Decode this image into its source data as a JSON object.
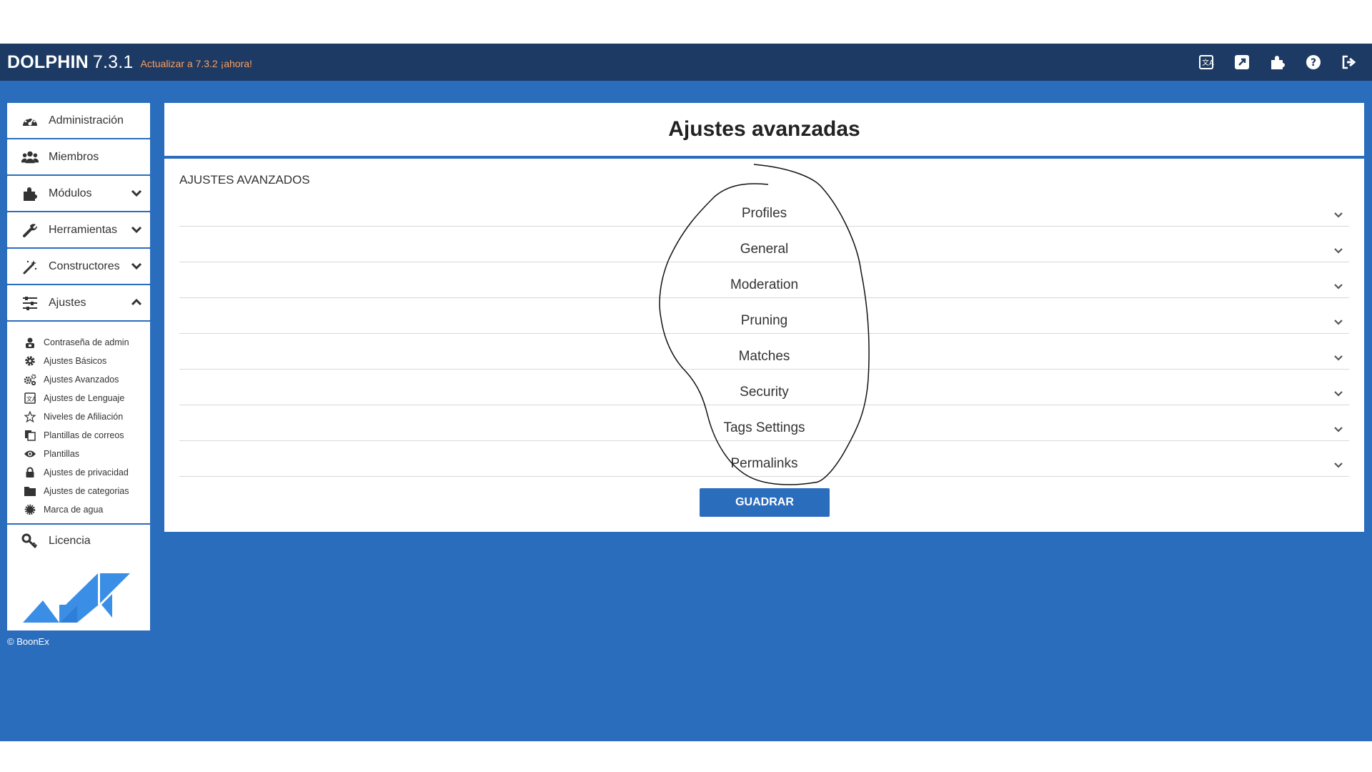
{
  "header": {
    "brand": "DOLPHIN",
    "version": "7.3.1",
    "upgrade_text": "Actualizar a 7.3.2 ¡ahora!",
    "icons": [
      "language-icon",
      "external-link-icon",
      "puzzle-icon",
      "help-icon",
      "logout-icon"
    ]
  },
  "sidebar": {
    "items": [
      {
        "label": "Administración",
        "icon": "dashboard-icon"
      },
      {
        "label": "Miembros",
        "icon": "users-icon"
      },
      {
        "label": "Módulos",
        "icon": "puzzle-icon"
      },
      {
        "label": "Herramientas",
        "icon": "wrench-icon"
      },
      {
        "label": "Constructores",
        "icon": "magic-wand-icon"
      },
      {
        "label": "Ajustes",
        "icon": "sliders-icon"
      }
    ],
    "submenu": [
      {
        "label": "Contraseña de admin",
        "icon": "admin-user-icon"
      },
      {
        "label": "Ajustes Básicos",
        "icon": "gear-icon"
      },
      {
        "label": "Ajustes Avanzados",
        "icon": "gears-icon"
      },
      {
        "label": "Ajustes de Lenguaje",
        "icon": "language-icon"
      },
      {
        "label": "Niveles de Afiliación",
        "icon": "star-icon"
      },
      {
        "label": "Plantillas de correos",
        "icon": "copy-icon"
      },
      {
        "label": "Plantillas",
        "icon": "eye-icon"
      },
      {
        "label": "Ajustes de privacidad",
        "icon": "lock-icon"
      },
      {
        "label": "Ajustes de categorias",
        "icon": "folder-icon"
      },
      {
        "label": "Marca de agua",
        "icon": "cog-badge-icon"
      }
    ],
    "license": {
      "label": "Licencia",
      "icon": "key-icon"
    },
    "copyright": "© BoonEx"
  },
  "main": {
    "title": "Ajustes avanzadas",
    "section_title": "AJUSTES AVANZADOS",
    "accordion": [
      "Profiles",
      "General",
      "Moderation",
      "Pruning",
      "Matches",
      "Security",
      "Tags Settings",
      "Permalinks"
    ],
    "save_label": "GUADRAR"
  },
  "colors": {
    "header_bg": "#1c3a63",
    "main_bg": "#2b6dbd",
    "upgrade_link": "#ff9e5e"
  }
}
